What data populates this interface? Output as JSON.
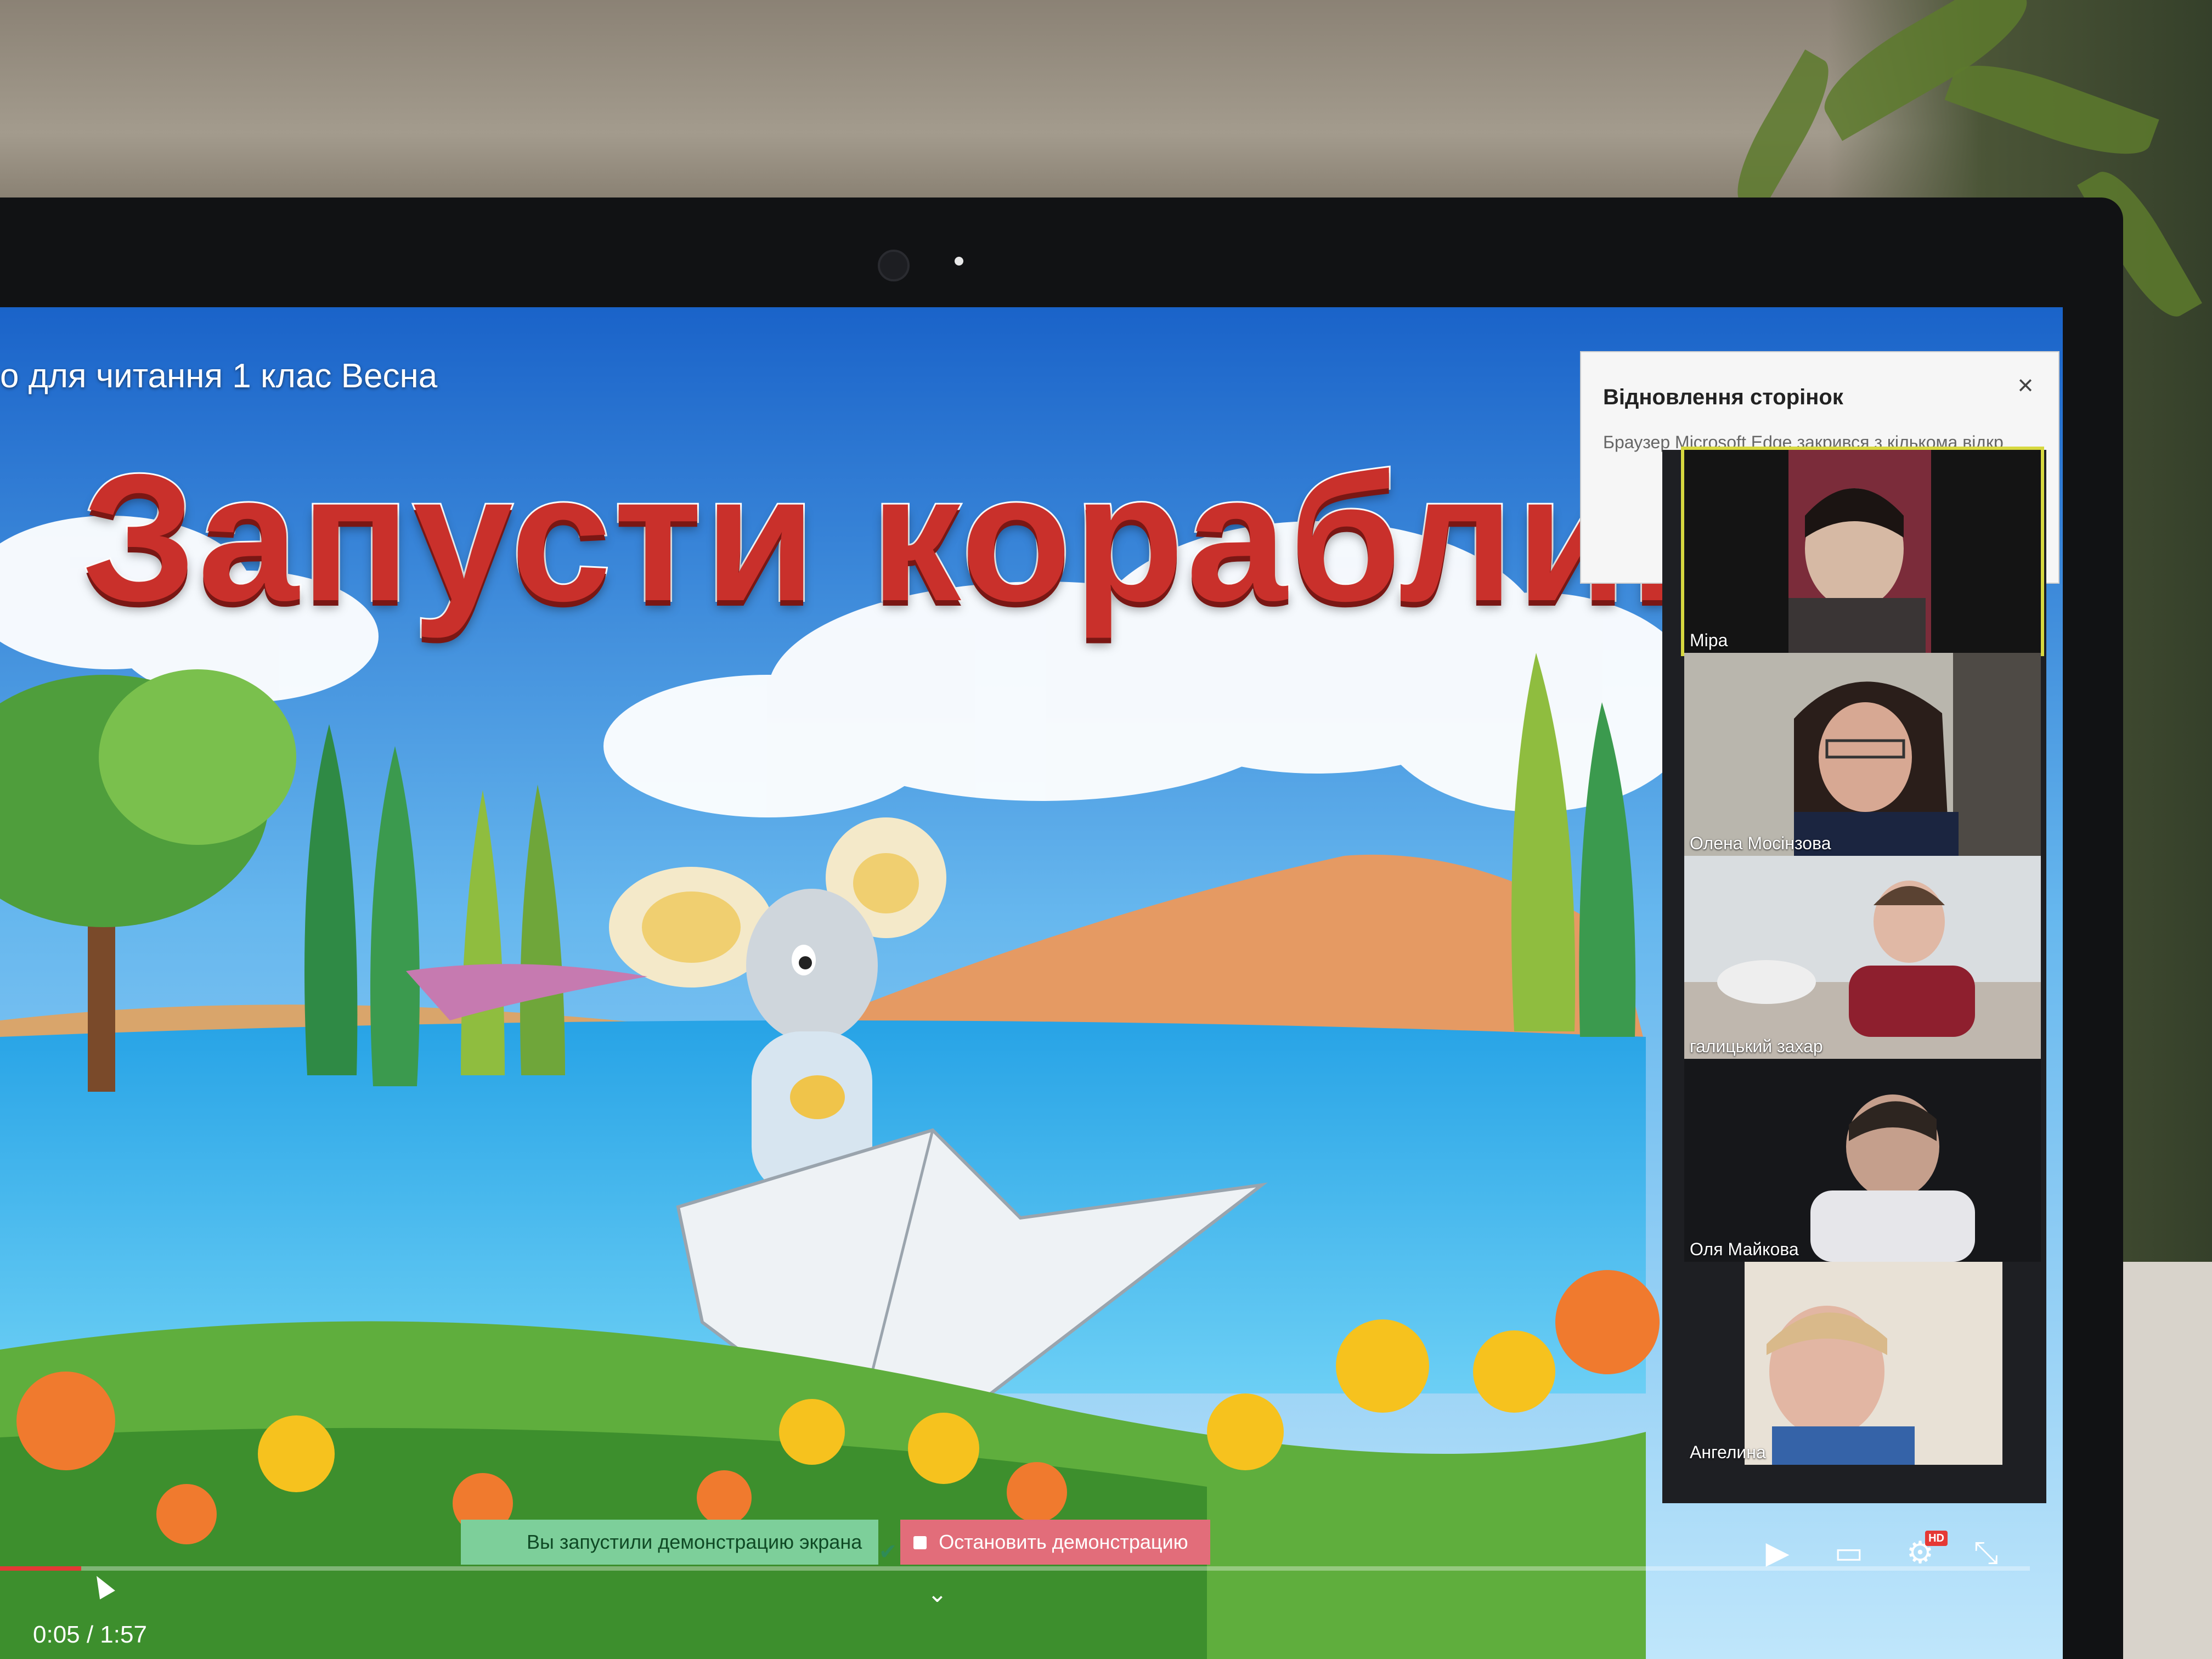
{
  "video": {
    "title": "о для читання 1 клас Весна",
    "headline": "Запусти кораблик"
  },
  "popup": {
    "title": "Відновлення сторінок",
    "body": "Браузер Microsoft Edge закрився з кількома відкр",
    "close_icon": "close-icon"
  },
  "participants": [
    {
      "name": "Міра",
      "active": true
    },
    {
      "name": "Олена Мосінзова",
      "active": false
    },
    {
      "name": "галицький захар",
      "active": false
    },
    {
      "name": "Оля Майкова",
      "active": false
    },
    {
      "name": "Ангелина",
      "active": false
    }
  ],
  "player": {
    "time": "0:05 / 1:57",
    "progress": 0.04,
    "icons": [
      "play-icon",
      "subtitles-icon",
      "settings-hd-icon",
      "exit-fullscreen-icon"
    ],
    "hd_label": "HD"
  },
  "screen_share": {
    "status_text": "Вы запустили демонстрацию экрана",
    "stop_label": "Остановить демонстрацию"
  },
  "colors": {
    "headline": "#c9302b",
    "active_tile_border": "#d7d83f",
    "share_green": "#7dcf9a",
    "share_red": "#e26d7a",
    "progress": "#e53935"
  }
}
